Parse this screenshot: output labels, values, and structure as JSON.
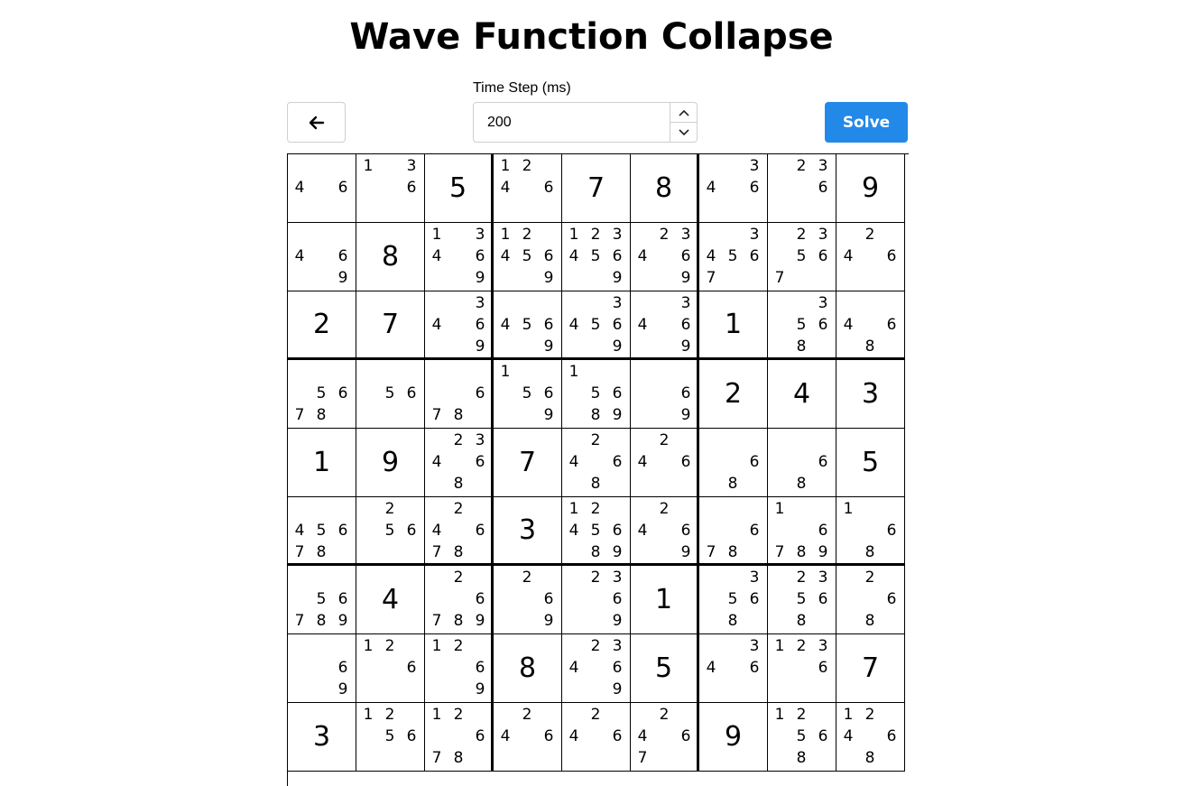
{
  "title": "Wave Function Collapse",
  "controls": {
    "back_icon": "arrow-left-icon",
    "time_step_label": "Time Step (ms)",
    "time_step_value": "200",
    "solve_label": "Solve"
  },
  "colors": {
    "accent": "#2289e8",
    "grid_line": "#000000"
  },
  "grid": [
    [
      "46",
      "136",
      "5",
      "1246",
      "7",
      "8",
      "346",
      "236",
      "9"
    ],
    [
      "469",
      "8",
      "13469",
      "124569",
      "1234569",
      "23469",
      "34567",
      "23567",
      "246"
    ],
    [
      "2",
      "7",
      "3469",
      "4569",
      "34569",
      "3469",
      "1",
      "3568",
      "468"
    ],
    [
      "5678",
      "56",
      "678",
      "1569",
      "15689",
      "69",
      "2",
      "4",
      "3"
    ],
    [
      "1",
      "9",
      "23468",
      "7",
      "2468",
      "246",
      "68",
      "68",
      "5"
    ],
    [
      "45678",
      "256",
      "24678",
      "3",
      "1245689",
      "2469",
      "678",
      "16789",
      "168"
    ],
    [
      "56789",
      "4",
      "26789",
      "269",
      "2369",
      "1",
      "3568",
      "23568",
      "268"
    ],
    [
      "69",
      "126",
      "1269",
      "8",
      "23469",
      "5",
      "346",
      "1236",
      "7"
    ],
    [
      "3",
      "1256",
      "12678",
      "246",
      "246",
      "2467",
      "9",
      "12568",
      "12468"
    ]
  ]
}
